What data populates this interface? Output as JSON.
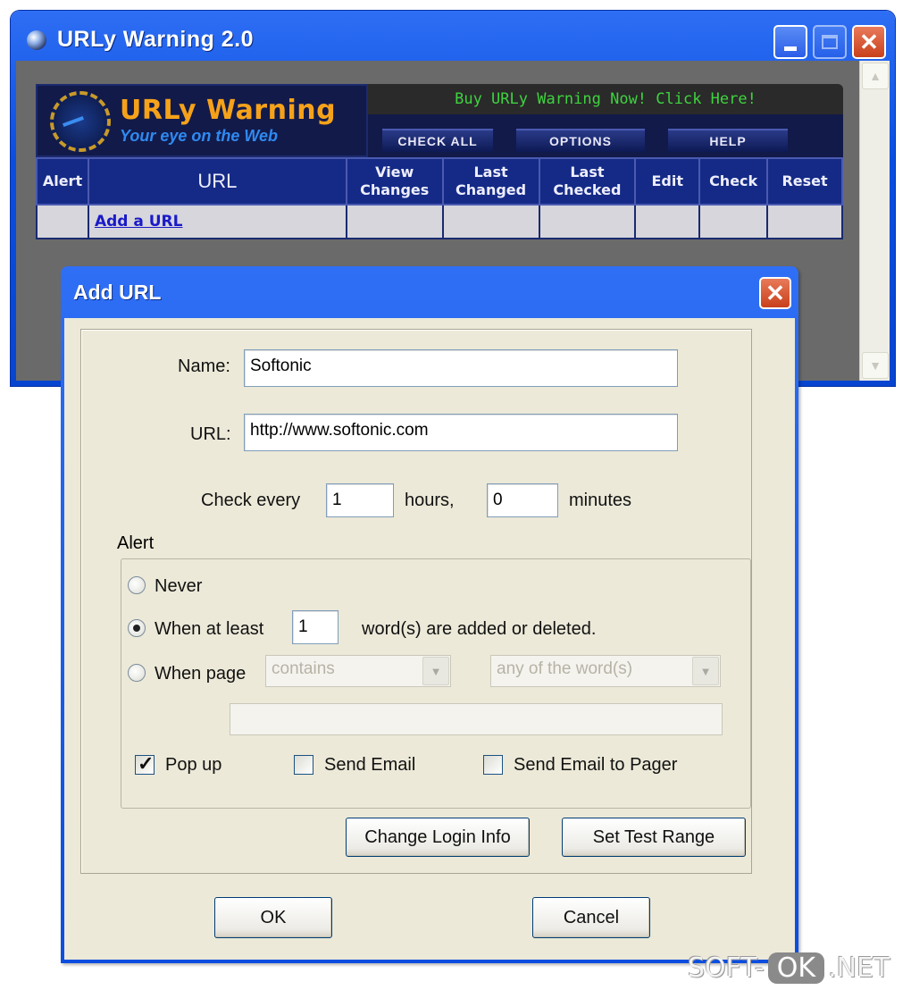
{
  "main_window": {
    "title": "URLy Warning 2.0",
    "banner": {
      "logo_title": "URLy Warning",
      "logo_tagline": "Your eye on the Web",
      "buy_text": "Buy URLy Warning Now! Click Here!",
      "nav": [
        "CHECK ALL",
        "OPTIONS",
        "HELP"
      ]
    },
    "table": {
      "headers": [
        "Alert",
        "URL",
        "View Changes",
        "Last Changed",
        "Last Checked",
        "Edit",
        "Check",
        "Reset"
      ],
      "add_link": "Add a URL"
    }
  },
  "dialog": {
    "title": "Add URL",
    "name_label": "Name:",
    "name_value": "Softonic",
    "url_label": "URL:",
    "url_value": "http://www.softonic.com",
    "check_every_label": "Check every",
    "hours_value": "1",
    "hours_label": "hours,",
    "minutes_value": "0",
    "minutes_label": "minutes",
    "alert": {
      "legend": "Alert",
      "never_label": "Never",
      "when_at_least_label": "When at least",
      "words_count": "1",
      "words_suffix": "word(s) are added or deleted.",
      "when_page_label": "When page",
      "condition_select": "contains",
      "match_select": "any of the word(s)",
      "selected_option": "when_at_least",
      "popup_label": "Pop up",
      "popup_checked": true,
      "send_email_label": "Send Email",
      "send_email_checked": false,
      "send_pager_label": "Send Email to Pager",
      "send_pager_checked": false
    },
    "change_login_label": "Change Login Info",
    "set_test_range_label": "Set Test Range",
    "ok_label": "OK",
    "cancel_label": "Cancel"
  },
  "watermark": {
    "left": "SOFT-",
    "ok": "OK",
    "right": ".NET"
  }
}
